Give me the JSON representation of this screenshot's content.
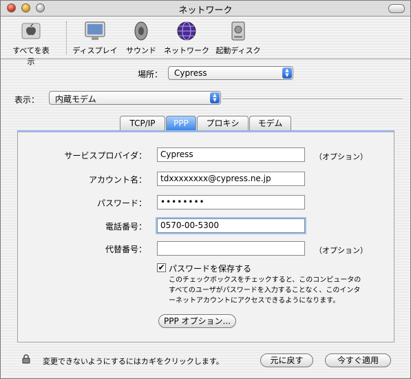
{
  "window": {
    "title": "ネットワーク"
  },
  "toolbar": {
    "show_all": "すべてを表示",
    "items": [
      "ディスプレイ",
      "サウンド",
      "ネットワーク",
      "起動ディスク"
    ]
  },
  "location": {
    "label": "場所：",
    "value": "Cypress"
  },
  "show": {
    "label": "表示：",
    "value": "内蔵モデム"
  },
  "tabs": [
    "TCP/IP",
    "PPP",
    "プロキシ",
    "モデム"
  ],
  "form": {
    "service_provider": {
      "label": "サービスプロバイダ：",
      "value": "Cypress",
      "optional": "（オプション）"
    },
    "account": {
      "label": "アカウント名：",
      "value": "tdxxxxxxxx@cypress.ne.jp"
    },
    "password": {
      "label": "パスワード：",
      "value": "••••••••"
    },
    "phone": {
      "label": "電話番号：",
      "value": "0570-00-5300"
    },
    "alt_number": {
      "label": "代替番号：",
      "value": "",
      "optional": "（オプション）"
    },
    "save_password": {
      "label": "パスワードを保存する",
      "checked": true,
      "note_lines": [
        "このチェックボックスをチェックすると、このコンピュータの",
        "すべてのユーザがパスワードを入力することなく、このインタ",
        "ーネットアカウントにアクセスできるようになります。"
      ]
    },
    "ppp_options_button": "PPP オプション..."
  },
  "footer": {
    "lock_text": "変更できないようにするにはカギをクリックします。",
    "revert_button": "元に戻す",
    "apply_button": "今すぐ適用"
  },
  "colors": {
    "accent": "#3d85e8",
    "focus": "#9cc3f0"
  }
}
